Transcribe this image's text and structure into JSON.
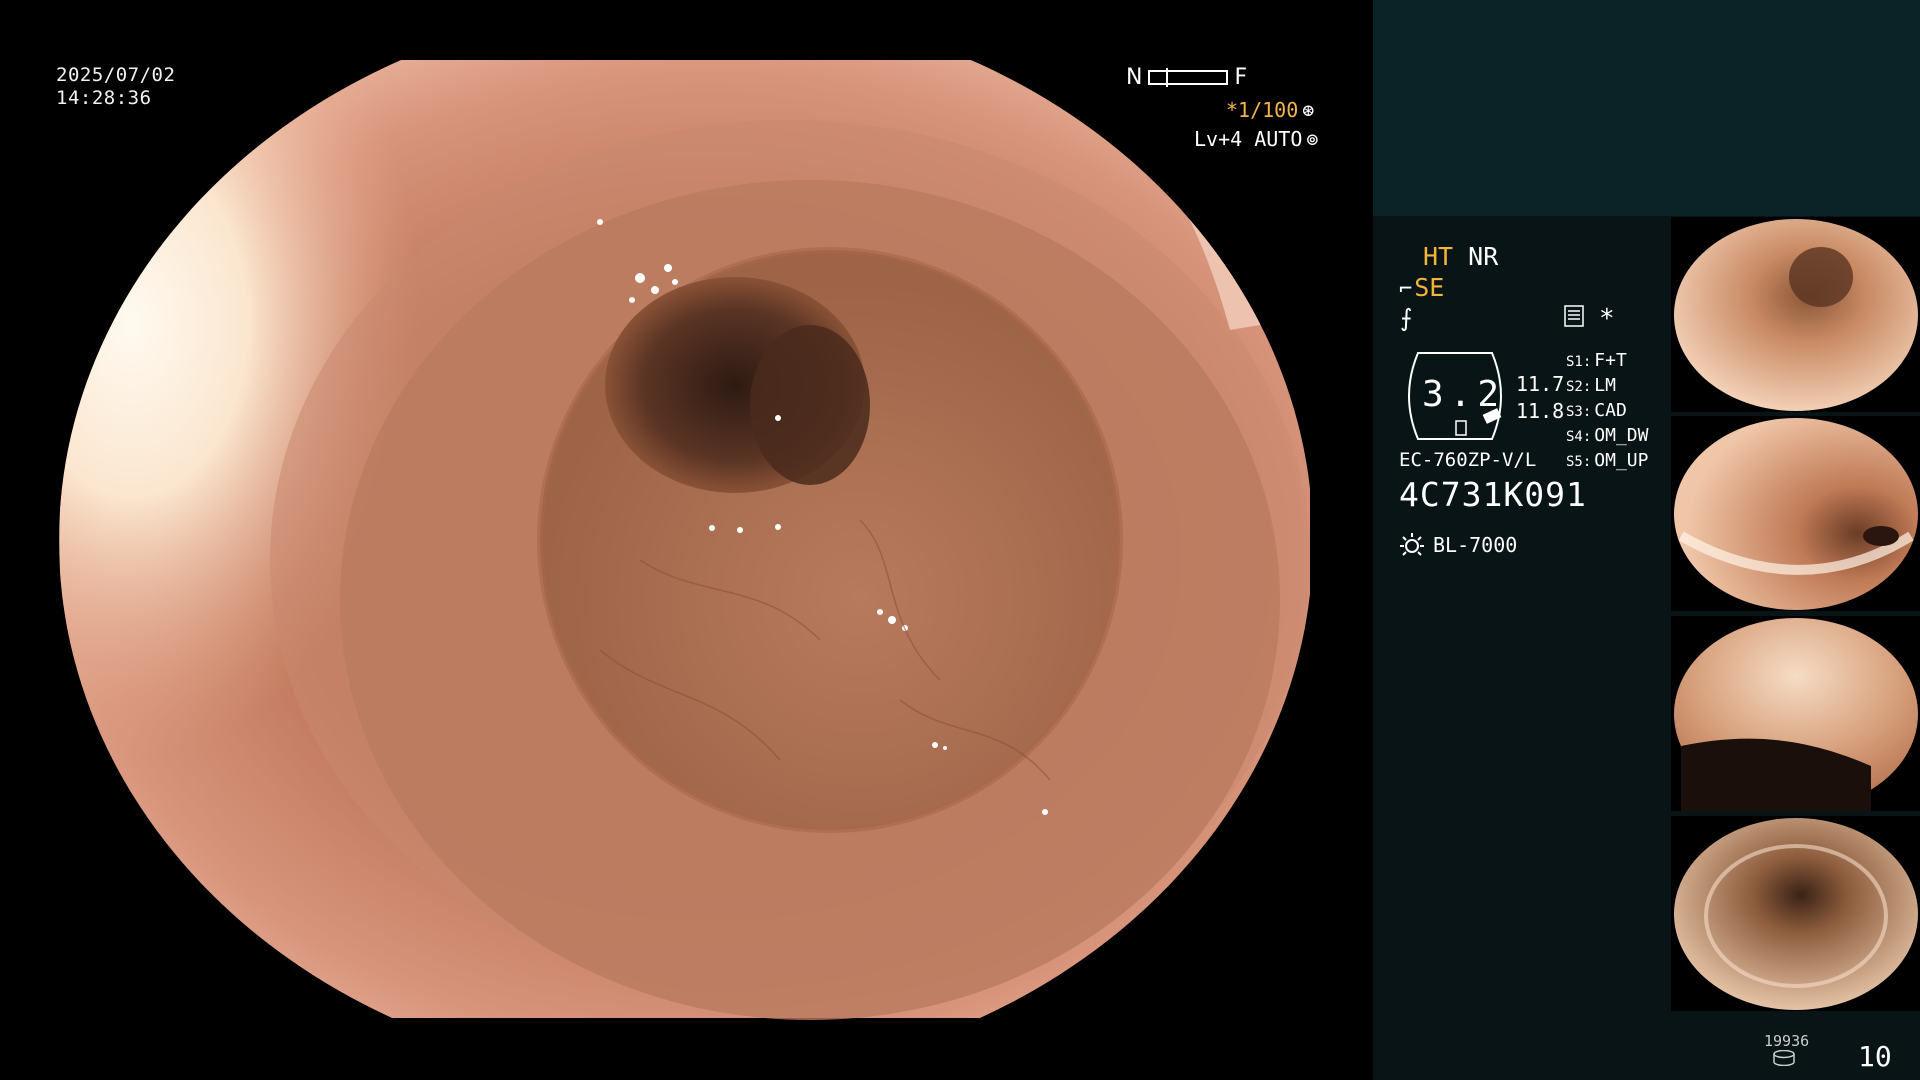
{
  "overlay": {
    "date": "2025/07/02",
    "time": "14:28:36",
    "near_label": "N",
    "far_label": "F",
    "shutter": "*1/100",
    "shutter_icon": "shutter-icon",
    "iris": "Lv+4 AUTO",
    "iris_icon": "iris-icon"
  },
  "panel": {
    "ht": "HT",
    "nr": "NR",
    "se": "SE",
    "se_icon": "structure-enhance-icon",
    "fx_icon": "color-mode-icon",
    "menu_icon": "document-icon",
    "star": "*",
    "zoom_value": "3.2",
    "zoom_line1": "11.7",
    "zoom_line2": "11.8",
    "switches": [
      {
        "key": "S1:",
        "value": "F+T"
      },
      {
        "key": "S2:",
        "value": "LM"
      },
      {
        "key": "S3:",
        "value": "CAD"
      },
      {
        "key": "S4:",
        "value": "OM_DW"
      },
      {
        "key": "S5:",
        "value": "OM_UP"
      }
    ],
    "scope_model": "EC-760ZP-V/L",
    "serial": "4C731K091",
    "light_source": "BL-7000",
    "light_icon": "light-source-icon",
    "image_count": "19936",
    "frame_count": "10",
    "colors": {
      "accent": "#f5b53c",
      "panel_bg": "#081416",
      "panel_top_bg": "#0b2226"
    }
  }
}
